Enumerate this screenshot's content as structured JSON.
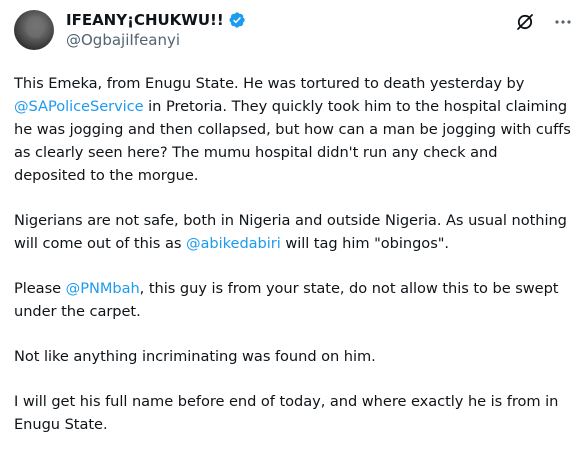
{
  "author": {
    "display_name": "IFEANY¡CHUKWU!!",
    "handle": "@OgbajiIfeanyi",
    "verified": true
  },
  "icons": {
    "verified": "verified-badge-icon",
    "grok": "grok-icon",
    "more": "more-options-icon"
  },
  "colors": {
    "link": "#1d9bf0",
    "verified": "#1d9bf0",
    "text": "#0f1419",
    "secondary": "#536471"
  },
  "tweet": {
    "p1": {
      "t1": "This Emeka, from Enugu State. He was tortured to death yesterday by ",
      "m1": "@SAPoliceService",
      "t2": " in Pretoria. They quickly took him to the hospital claiming he was jogging and then collapsed, but how can a man be jogging with cuffs as clearly seen here? The mumu hospital didn't run any check and deposited to the morgue."
    },
    "p2": {
      "t1": "Nigerians are not safe, both in Nigeria and outside Nigeria. As usual nothing will come out of this as ",
      "m1": "@abikedabiri",
      "t2": " will tag him \"obingos\"."
    },
    "p3": {
      "t1": "Please ",
      "m1": "@PNMbah",
      "t2": ", this guy is from your state, do not allow this to be swept under the carpet."
    },
    "p4": {
      "t1": "Not like anything incriminating was found on him."
    },
    "p5": {
      "t1": "I will get his full name before end of today,  and where exactly he is from in Enugu State."
    }
  }
}
